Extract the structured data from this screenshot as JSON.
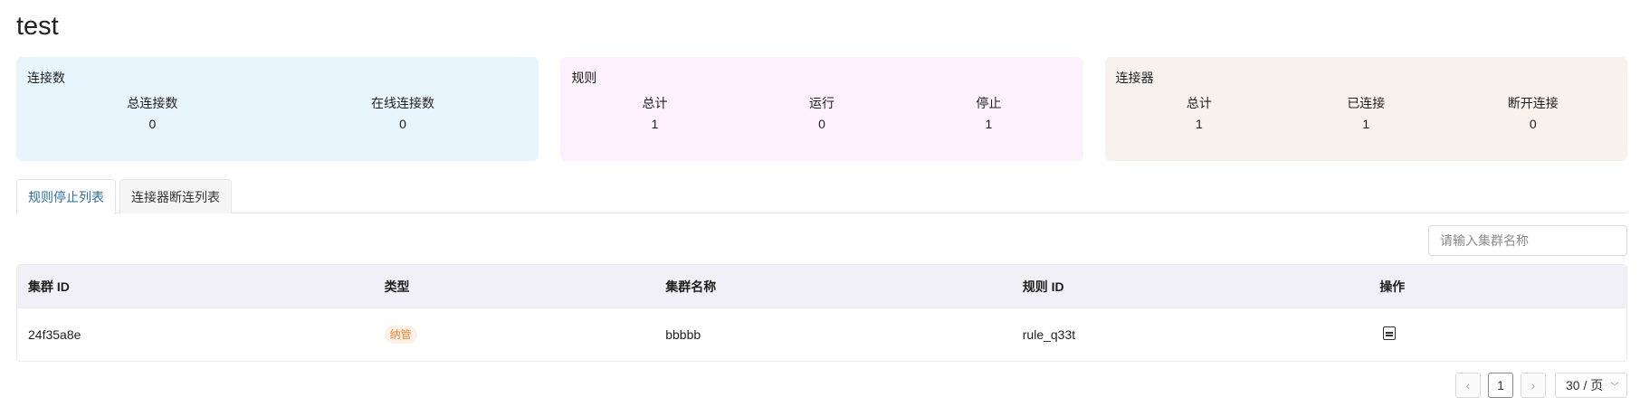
{
  "page": {
    "title": "test"
  },
  "cards": [
    {
      "title": "连接数",
      "bg": "#e8f5fd",
      "stats": [
        {
          "label": "总连接数",
          "value": "0"
        },
        {
          "label": "在线连接数",
          "value": "0"
        }
      ]
    },
    {
      "title": "规则",
      "bg": "#fdf2fb",
      "stats": [
        {
          "label": "总计",
          "value": "1"
        },
        {
          "label": "运行",
          "value": "0"
        },
        {
          "label": "停止",
          "value": "1"
        }
      ]
    },
    {
      "title": "连接器",
      "bg": "#f7f2ee",
      "stats": [
        {
          "label": "总计",
          "value": "1"
        },
        {
          "label": "已连接",
          "value": "1"
        },
        {
          "label": "断开连接",
          "value": "0"
        }
      ]
    }
  ],
  "tabs": [
    {
      "label": "规则停止列表",
      "active": true
    },
    {
      "label": "连接器断连列表",
      "active": false
    }
  ],
  "search": {
    "placeholder": "请输入集群名称",
    "value": ""
  },
  "table": {
    "headers": [
      "集群 ID",
      "类型",
      "集群名称",
      "规则 ID",
      "操作"
    ],
    "rows": [
      {
        "cluster_id": "24f35a8e",
        "type": "纳管",
        "cluster_name": "bbbbb",
        "rule_id": "rule_q33t",
        "action_icon": "document-icon"
      }
    ]
  },
  "pagination": {
    "prev_icon": "chevron-left-icon",
    "next_icon": "chevron-right-icon",
    "current_page": "1",
    "page_size": "30 / 页"
  },
  "colors": {
    "tab_active": "#2f6ea5",
    "tag_text": "#e8893b",
    "tag_bg": "#fdf0e4",
    "table_header_bg": "#f0f0f6"
  }
}
